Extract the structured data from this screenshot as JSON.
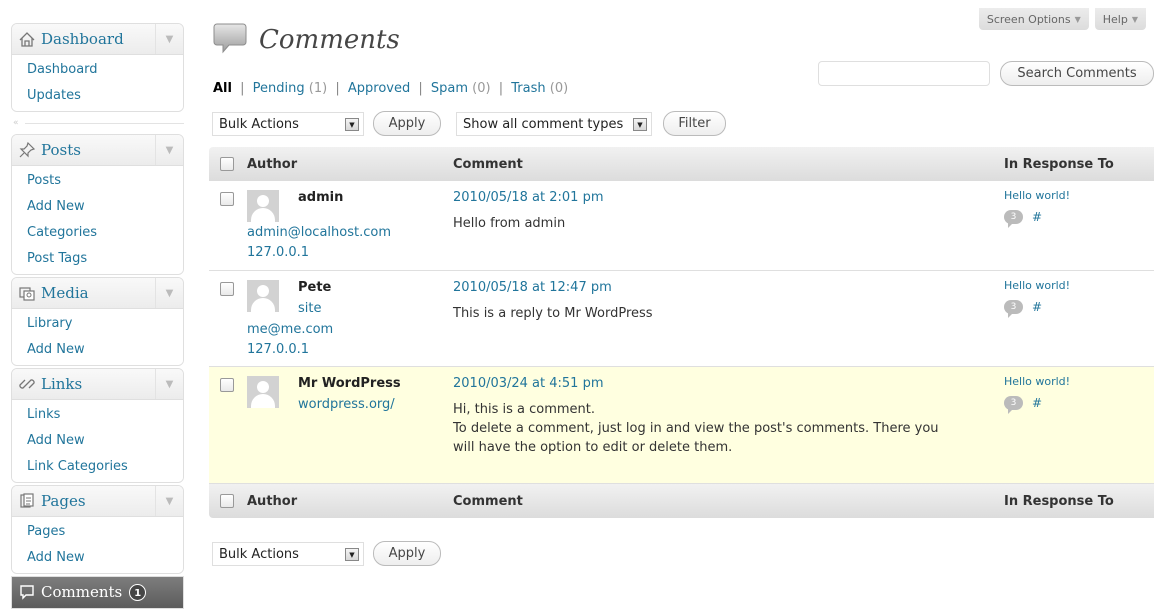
{
  "screen_meta": {
    "screen_options": "Screen Options",
    "help": "Help",
    "tri": "▼"
  },
  "sidebar": {
    "dashboard": {
      "label": "Dashboard",
      "items": [
        "Dashboard",
        "Updates"
      ]
    },
    "collapse_icon": "«",
    "posts": {
      "label": "Posts",
      "items": [
        "Posts",
        "Add New",
        "Categories",
        "Post Tags"
      ]
    },
    "media": {
      "label": "Media",
      "items": [
        "Library",
        "Add New"
      ]
    },
    "links": {
      "label": "Links",
      "items": [
        "Links",
        "Add New",
        "Link Categories"
      ]
    },
    "pages": {
      "label": "Pages",
      "items": [
        "Pages",
        "Add New"
      ]
    },
    "comments": {
      "label": "Comments",
      "badge": "1"
    },
    "arrow": "▼"
  },
  "page": {
    "title": "Comments"
  },
  "filters": {
    "all": "All",
    "pending": "Pending",
    "pending_count": "(1)",
    "approved": "Approved",
    "spam": "Spam",
    "spam_count": "(0)",
    "trash": "Trash",
    "trash_count": "(0)",
    "sep": "|"
  },
  "search": {
    "value": "",
    "button": "Search Comments"
  },
  "toolbar": {
    "bulk_actions": "Bulk Actions",
    "apply": "Apply",
    "comment_types": "Show all comment types",
    "filter": "Filter",
    "dd": "▼"
  },
  "table": {
    "headers": {
      "author": "Author",
      "comment": "Comment",
      "response": "In Response To"
    },
    "rows": [
      {
        "author": "admin",
        "site": "",
        "email": "admin@localhost.com",
        "ip": "127.0.0.1",
        "date": "2010/05/18 at 2:01 pm",
        "text": "Hello from admin",
        "post": "Hello world!",
        "count": "3",
        "hash": "#"
      },
      {
        "author": "Pete",
        "site": "site",
        "email": "me@me.com",
        "ip": "127.0.0.1",
        "date": "2010/05/18 at 12:47 pm",
        "text": "This is a reply to Mr WordPress",
        "post": "Hello world!",
        "count": "3",
        "hash": "#"
      },
      {
        "author": "Mr WordPress",
        "site": "wordpress.org/",
        "email": "",
        "ip": "",
        "date": "2010/03/24 at 4:51 pm",
        "text_line1": "Hi, this is a comment.",
        "text_line2": "To delete a comment, just log in and view the post's comments. There you",
        "text_line3": "will have the option to edit or delete them.",
        "post": "Hello world!",
        "count": "3",
        "hash": "#"
      }
    ]
  },
  "colors": {
    "link": "#21759b",
    "unapproved_row": "#ffffe0",
    "active_menu": "#6d6d6d"
  }
}
